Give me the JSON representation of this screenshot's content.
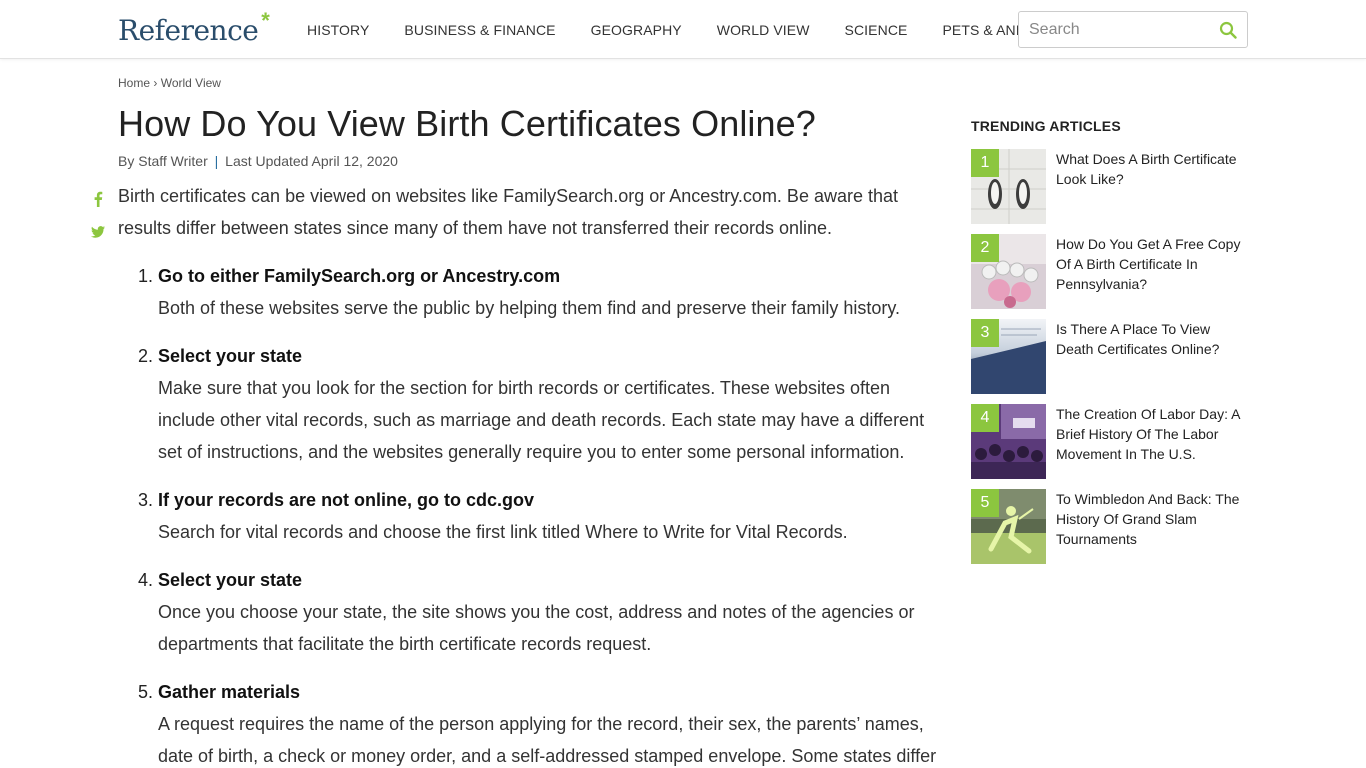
{
  "header": {
    "logo": "Reference",
    "logo_mark": "*",
    "nav": [
      "HISTORY",
      "BUSINESS & FINANCE",
      "GEOGRAPHY",
      "WORLD VIEW",
      "SCIENCE",
      "PETS & ANIMALS"
    ],
    "search_placeholder": "Search",
    "search_icon": "search-icon"
  },
  "breadcrumb": {
    "home": "Home",
    "separator": "›",
    "section": "World View"
  },
  "article": {
    "title": "How Do You View Birth Certificates Online?",
    "author": "By Staff Writer",
    "byline_sep": "|",
    "updated": "Last Updated April 12, 2020",
    "intro": "Birth certificates can be viewed on websites like FamilySearch.org or Ancestry.com. Be aware that results differ between states since many of them have not transferred their records online.",
    "steps": [
      {
        "num": "1.",
        "title": "Go to either FamilySearch.org or Ancestry.com",
        "desc": "Both of these websites serve the public by helping them find and preserve their family history."
      },
      {
        "num": "2.",
        "title": "Select your state",
        "desc": "Make sure that you look for the section for birth records or certificates. These websites often include other vital records, such as marriage and death records. Each state may have a different set of instructions, and the websites generally require you to enter some personal information."
      },
      {
        "num": "3.",
        "title": "If your records are not online, go to cdc.gov",
        "desc": "Search for vital records and choose the first link titled Where to Write for Vital Records."
      },
      {
        "num": "4.",
        "title": "Select your state",
        "desc": "Once you choose your state, the site shows you the cost, address and notes of the agencies or departments that facilitate the birth certificate records request."
      },
      {
        "num": "5.",
        "title": "Gather materials",
        "desc": "A request requires the name of the person applying for the record, their sex, the parents’ names, date of birth, a check or money order, and a self-addressed stamped envelope. Some states differ"
      }
    ]
  },
  "share": {
    "facebook_icon": "facebook-icon",
    "twitter_icon": "twitter-icon"
  },
  "trending": {
    "heading": "TRENDING ARTICLES",
    "items": [
      {
        "rank": "1",
        "title": "What Does A Birth Certificate Look Like?"
      },
      {
        "rank": "2",
        "title": "How Do You Get A Free Copy Of A Birth Certificate In Pennsylvania?"
      },
      {
        "rank": "3",
        "title": "Is There A Place To View Death Certificates Online?"
      },
      {
        "rank": "4",
        "title": "The Creation Of Labor Day: A Brief History Of The Labor Movement In The U.S."
      },
      {
        "rank": "5",
        "title": "To Wimbledon And Back: The History Of Grand Slam Tournaments"
      }
    ]
  },
  "colors": {
    "accent": "#8cc63f",
    "logo": "#2a4d6b",
    "byline_sep": "#2a6fa0"
  }
}
